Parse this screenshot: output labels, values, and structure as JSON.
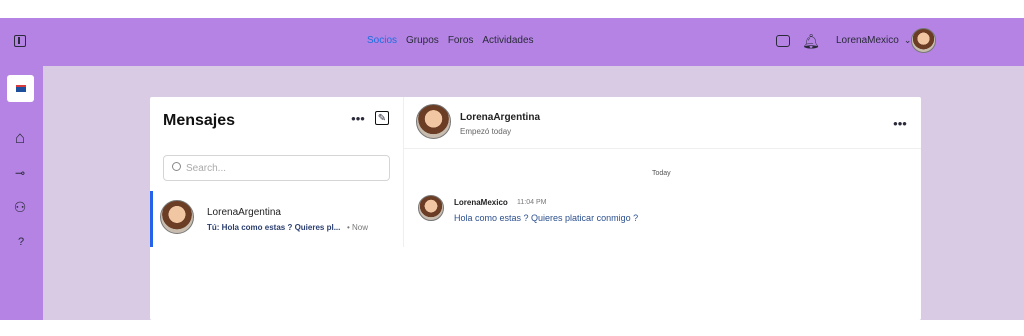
{
  "nav": {
    "items": [
      "Socios",
      "Grupos",
      "Foros",
      "Actividades"
    ],
    "active_index": 0
  },
  "header": {
    "username": "LorenaMexico"
  },
  "messages": {
    "title": "Mensajes",
    "search_placeholder": "Search..."
  },
  "conversation": {
    "name": "LorenaArgentina",
    "preview": "Tú: Hola como estas ? Quieres pl...",
    "time": "• Now"
  },
  "chat": {
    "name": "LorenaArgentina",
    "started": "Empezó today",
    "date_divider": "Today",
    "message": {
      "author": "LorenaMexico",
      "time": "11:04 PM",
      "text": "Hola como estas ? Quieres platicar conmigo ?"
    }
  },
  "icons": [
    "panel-toggle-icon",
    "app-logo-icon",
    "home-icon",
    "key-icon",
    "user-add-icon",
    "help-icon",
    "inbox-icon",
    "bell-icon",
    "chevron-down-icon",
    "more-icon",
    "edit-icon",
    "search-icon"
  ],
  "colors": {
    "purple": "#b483e3",
    "lavender": "#d9cbe3",
    "active_link": "#1d6fe0",
    "selected_border": "#2563eb"
  }
}
